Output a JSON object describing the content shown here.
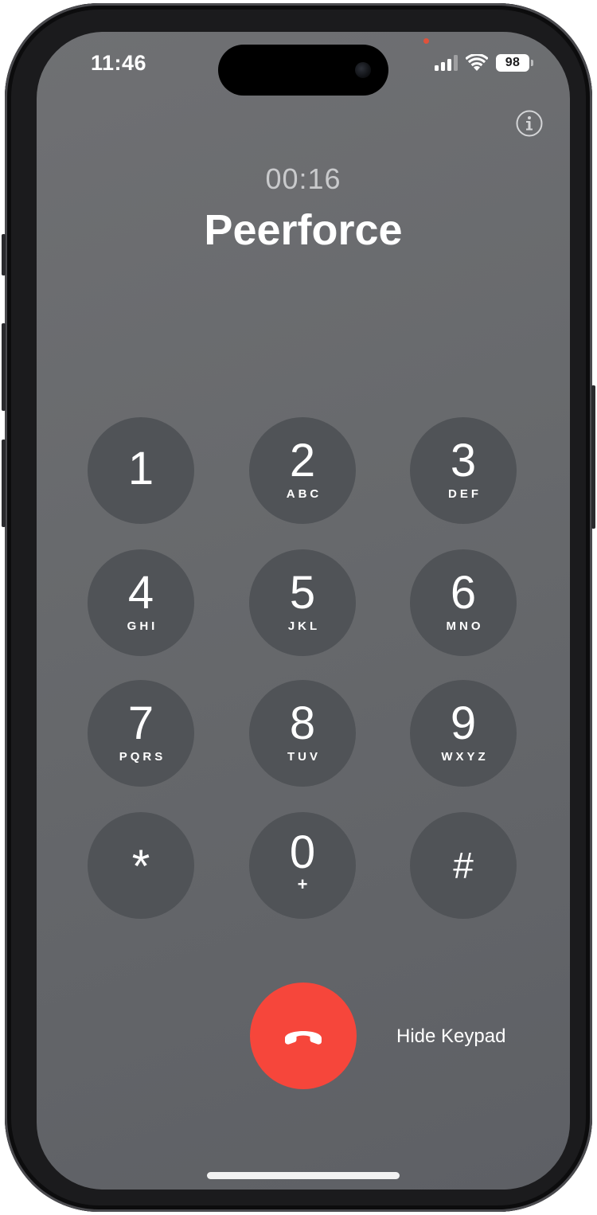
{
  "status_bar": {
    "time": "11:46",
    "battery_level": "98",
    "signal_bars_active": 3,
    "signal_bars_total": 4,
    "icons": [
      "cellular-signal-icon",
      "wifi-icon",
      "battery-icon"
    ]
  },
  "call": {
    "duration": "00:16",
    "caller_name": "Peerforce"
  },
  "keypad": {
    "keys": [
      {
        "digit": "1",
        "letters": ""
      },
      {
        "digit": "2",
        "letters": "ABC"
      },
      {
        "digit": "3",
        "letters": "DEF"
      },
      {
        "digit": "4",
        "letters": "GHI"
      },
      {
        "digit": "5",
        "letters": "JKL"
      },
      {
        "digit": "6",
        "letters": "MNO"
      },
      {
        "digit": "7",
        "letters": "PQRS"
      },
      {
        "digit": "8",
        "letters": "TUV"
      },
      {
        "digit": "9",
        "letters": "WXYZ"
      },
      {
        "digit": "*",
        "letters": ""
      },
      {
        "digit": "0",
        "letters": "+"
      },
      {
        "digit": "#",
        "letters": ""
      }
    ]
  },
  "controls": {
    "hide_keypad_label": "Hide Keypad",
    "end_call_icon": "end-call-icon",
    "info_icon": "info-icon"
  },
  "colors": {
    "end_call": "#f6463b",
    "key_background": "#505357",
    "screen_background": "#6a6b6f"
  }
}
